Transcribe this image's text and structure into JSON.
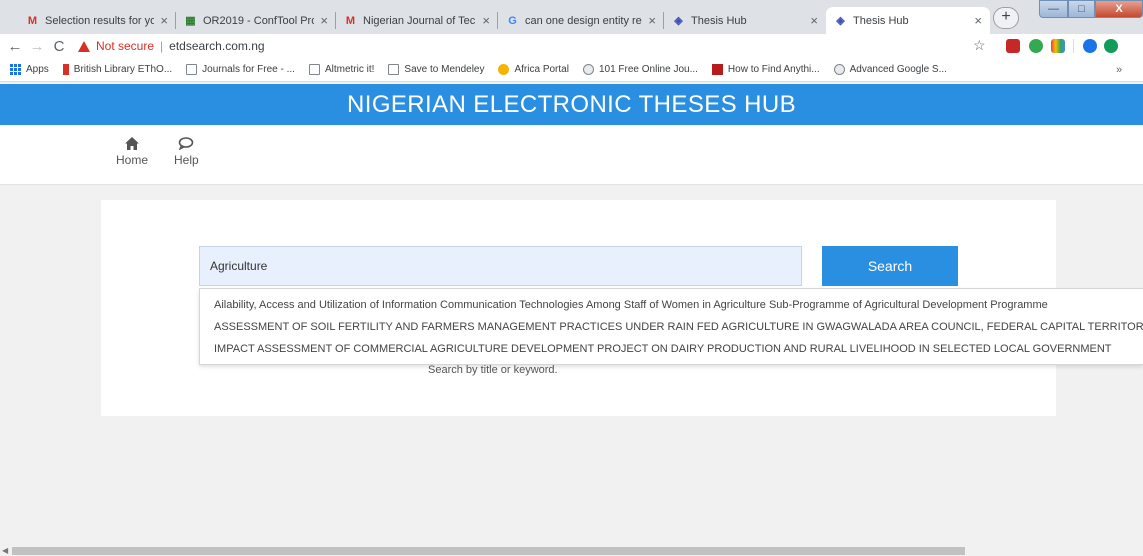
{
  "browser": {
    "tabs": [
      {
        "title": "Selection results for you",
        "icon": "gmail-icon",
        "icon_glyph": "M",
        "icon_color": "#d93025"
      },
      {
        "title": "OR2019 - ConfTool Pro",
        "icon": "conftool-icon",
        "icon_glyph": "▦",
        "icon_color": "#2e7d32"
      },
      {
        "title": "Nigerian Journal of Tech",
        "icon": "gmail-icon",
        "icon_glyph": "M",
        "icon_color": "#d93025"
      },
      {
        "title": "can one design entity re",
        "icon": "google-icon",
        "icon_glyph": "G",
        "icon_color": "#4285f4"
      },
      {
        "title": "Thesis Hub",
        "icon": "thesis-hub-icon",
        "icon_glyph": "◈",
        "icon_color": "#3f51b5"
      },
      {
        "title": "Thesis Hub",
        "icon": "thesis-hub-icon",
        "icon_glyph": "◈",
        "icon_color": "#3f51b5"
      }
    ],
    "active_tab": 5,
    "close_glyph": "×",
    "new_tab_glyph": "+",
    "window_controls": {
      "minimize": "—",
      "maximize": "□",
      "close": "X"
    },
    "nav": {
      "back": "←",
      "forward": "→",
      "reload": "C"
    },
    "security_label": "Not secure",
    "url": "etdsearch.com.ng",
    "star_glyph": "☆",
    "bookmarks": [
      {
        "label": "Apps",
        "icon": "apps-grid-icon"
      },
      {
        "label": "British Library EThO...",
        "icon": "bookmark-icon"
      },
      {
        "label": "Journals for Free - ...",
        "icon": "page-icon"
      },
      {
        "label": "Altmetric it!",
        "icon": "page-icon"
      },
      {
        "label": "Save to Mendeley",
        "icon": "page-icon"
      },
      {
        "label": "Africa Portal",
        "icon": "africa-portal-icon"
      },
      {
        "label": "101 Free Online Jou...",
        "icon": "globe-icon"
      },
      {
        "label": "How to Find Anythi...",
        "icon": "bookmark-icon"
      },
      {
        "label": "Advanced Google S...",
        "icon": "globe-icon"
      }
    ],
    "bookmarks_overflow": "»"
  },
  "site": {
    "title": "NIGERIAN ELECTRONIC THESES HUB",
    "nav": [
      {
        "label": "Home",
        "icon": "home-icon",
        "glyph": "⌂"
      },
      {
        "label": "Help",
        "icon": "chat-bubble-icon",
        "glyph": "💬"
      }
    ]
  },
  "search": {
    "value": "Agriculture",
    "button_label": "Search",
    "hint": "Search by title or keyword.",
    "suggestions": [
      "Ailability, Access and Utilization of Information Communication Technologies Among Staff of Women in Agriculture Sub-Programme of Agricultural Development Programme",
      "ASSESSMENT OF SOIL FERTILITY AND FARMERS MANAGEMENT PRACTICES UNDER RAIN FED AGRICULTURE IN GWAGWALADA AREA COUNCIL, FEDERAL CAPITAL TERRITORY",
      "IMPACT ASSESSMENT OF COMMERCIAL AGRICULTURE DEVELOPMENT PROJECT ON DAIRY PRODUCTION AND RURAL LIVELIHOOD IN SELECTED LOCAL GOVERNMENT"
    ]
  },
  "colors": {
    "brand_blue": "#2a8fe0",
    "input_bg": "#e8f0fe",
    "not_secure_red": "#d93025"
  }
}
